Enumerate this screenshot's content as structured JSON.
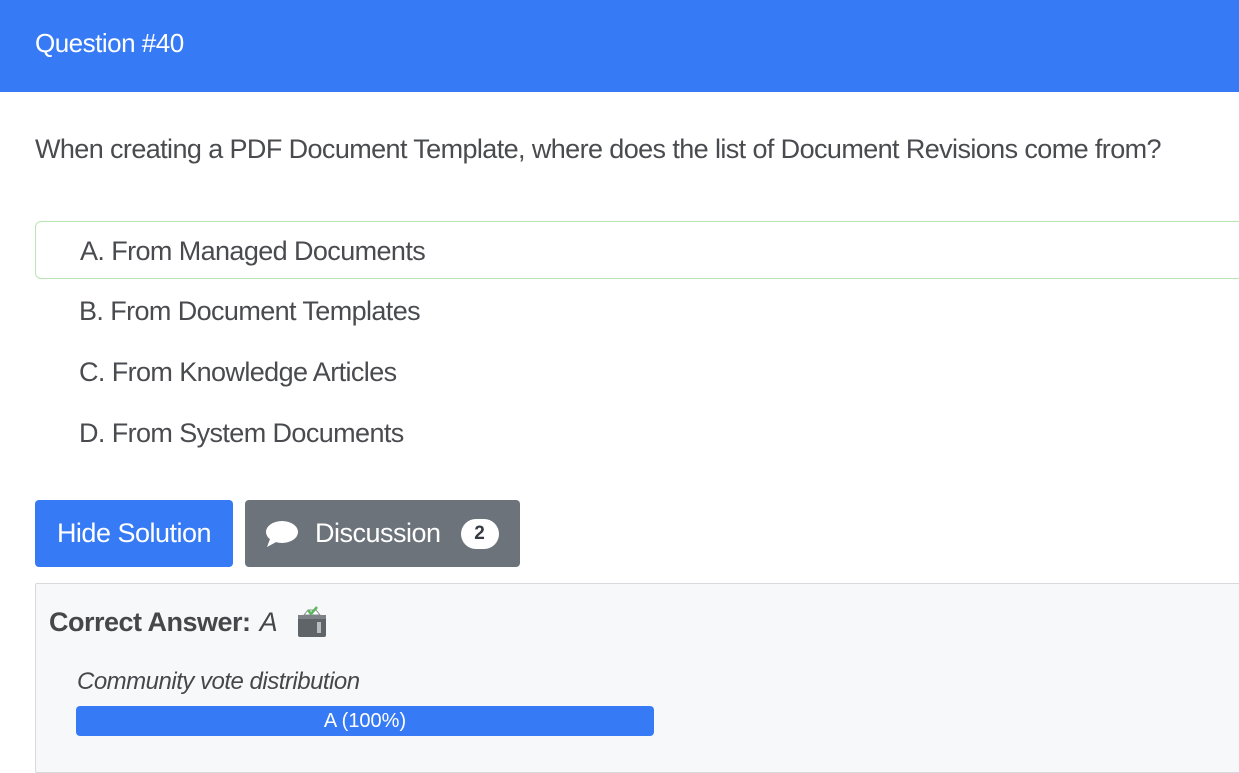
{
  "header": {
    "title": "Question #40",
    "color": "#377af5"
  },
  "question": {
    "text": "When creating a PDF Document Template, where does the list of Document Revisions come from?"
  },
  "choices": [
    {
      "label": "A. From Managed Documents",
      "selected": true
    },
    {
      "label": "B. From Document Templates",
      "selected": false
    },
    {
      "label": "C. From Knowledge Articles",
      "selected": false
    },
    {
      "label": "D. From System Documents",
      "selected": false
    }
  ],
  "buttons": {
    "hide_solution": "Hide Solution",
    "discussion": "Discussion",
    "discussion_count": "2",
    "discussion_icon": "chat-bubble-icon"
  },
  "answer": {
    "label": "Correct Answer:",
    "value": "A",
    "icon": "ballot-box-icon",
    "vote_title": "Community vote distribution",
    "vote_bar_text": "A (100%)",
    "vote_percent": 100
  }
}
